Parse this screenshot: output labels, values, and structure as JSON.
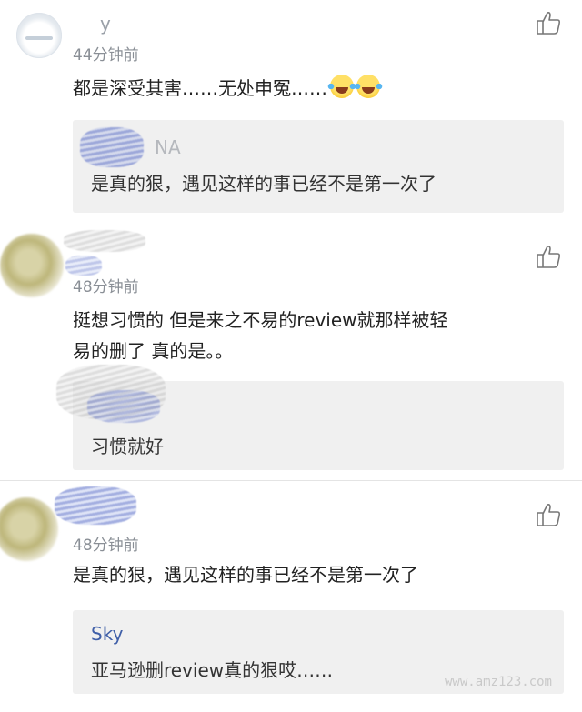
{
  "comments": [
    {
      "time": "44分钟前",
      "text": "都是深受其害……无处申冤……",
      "emojis": [
        "tears-of-joy",
        "tears-of-joy"
      ],
      "name_partial": "y",
      "reply": {
        "author_partial": "NA",
        "text": "是真的狠，遇见这样的事已经不是第一次了"
      }
    },
    {
      "time": "48分钟前",
      "text_line1": "挺想习惯的 但是来之不易的review就那样被轻",
      "text_line2": "易的删了 真的是。。",
      "reply": {
        "text": "习惯就好"
      }
    },
    {
      "time": "48分钟前",
      "text": "是真的狠，遇见这样的事已经不是第一次了",
      "reply": {
        "author": "Sky",
        "text": "亚马逊删review真的狠哎……"
      }
    }
  ],
  "watermark": "www.amz123.com",
  "colors": {
    "reply_bg": "#f0f0f0",
    "reply_name": "#3f5fa8",
    "meta": "#8a8f96"
  }
}
